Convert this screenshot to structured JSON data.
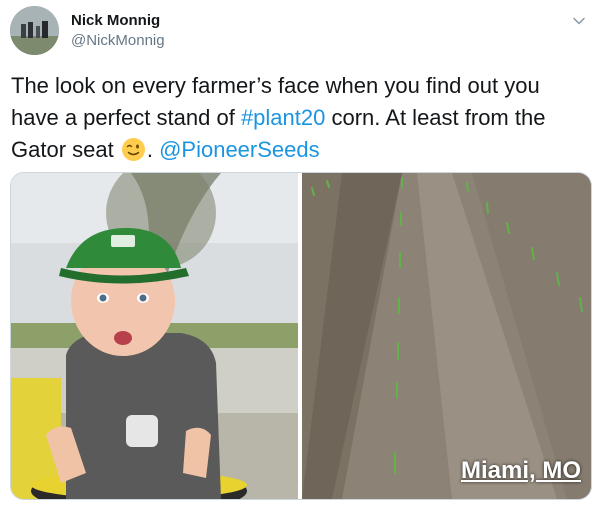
{
  "user": {
    "display_name": "Nick Monnig",
    "handle": "@NickMonnig"
  },
  "tweet": {
    "text_part1": "The look on every farmer’s face when you find out you have a perfect stand of ",
    "hashtag": "#plant20",
    "text_part2": " corn. At least from the Gator seat ",
    "emoji": "winking-face",
    "text_part3": ". ",
    "mention": "@PioneerSeeds"
  },
  "media": {
    "left_photo": "baby-in-green-cap-photo",
    "right_photo": "corn-field-rows-photo",
    "location_caption": "Miami, MO"
  },
  "colors": {
    "link": "#1b95e0",
    "text": "#14171a",
    "secondary": "#657786",
    "border": "#ccd6dd"
  }
}
